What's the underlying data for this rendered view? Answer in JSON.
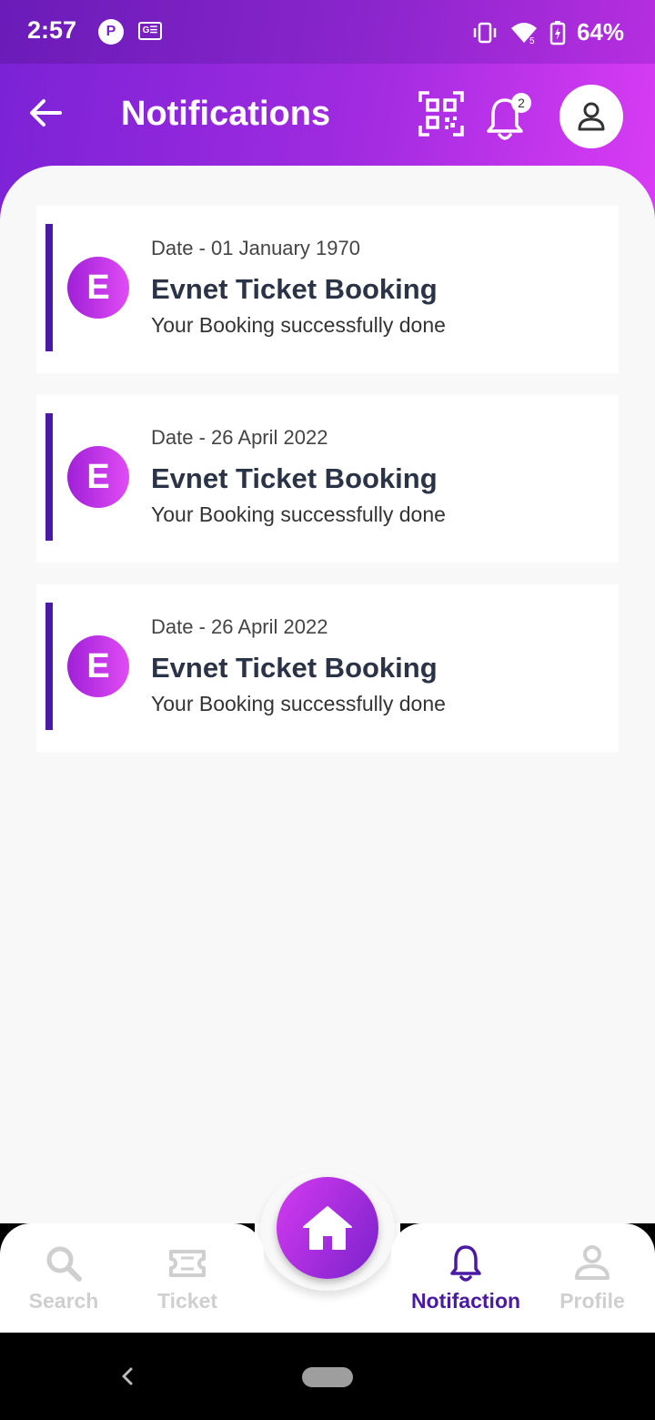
{
  "status_bar": {
    "time": "2:57",
    "app_icon_1": "P",
    "app_icon_2": "G☰",
    "battery_percent": "64%",
    "icons": [
      "vibrate-icon",
      "wifi-icon",
      "battery-charging-icon"
    ]
  },
  "header": {
    "title": "Notifications",
    "notification_count": "2",
    "icons": [
      "back-arrow-icon",
      "qr-code-icon",
      "bell-icon",
      "user-icon"
    ]
  },
  "notifications": [
    {
      "initial": "E",
      "date": "Date - 01 January 1970",
      "title": "Evnet Ticket Booking",
      "message": "Your Booking successfully done"
    },
    {
      "initial": "E",
      "date": "Date - 26 April 2022",
      "title": "Evnet Ticket Booking",
      "message": "Your Booking successfully done"
    },
    {
      "initial": "E",
      "date": "Date - 26 April 2022",
      "title": "Evnet Ticket Booking",
      "message": "Your Booking successfully done"
    }
  ],
  "bottom_nav": {
    "items": [
      {
        "label": "Search",
        "icon": "search-icon",
        "active": false
      },
      {
        "label": "Ticket",
        "icon": "ticket-icon",
        "active": false
      },
      {
        "label": "Notifaction",
        "icon": "bell-icon",
        "active": true
      },
      {
        "label": "Profile",
        "icon": "user-icon",
        "active": false
      }
    ],
    "center_icon": "home-icon"
  },
  "colors": {
    "brand_gradient_start": "#7a22d6",
    "brand_gradient_end": "#d93cf4",
    "accent": "#4a1aa6",
    "inactive_nav": "#cfcfcf",
    "card_title": "#2b3347"
  }
}
